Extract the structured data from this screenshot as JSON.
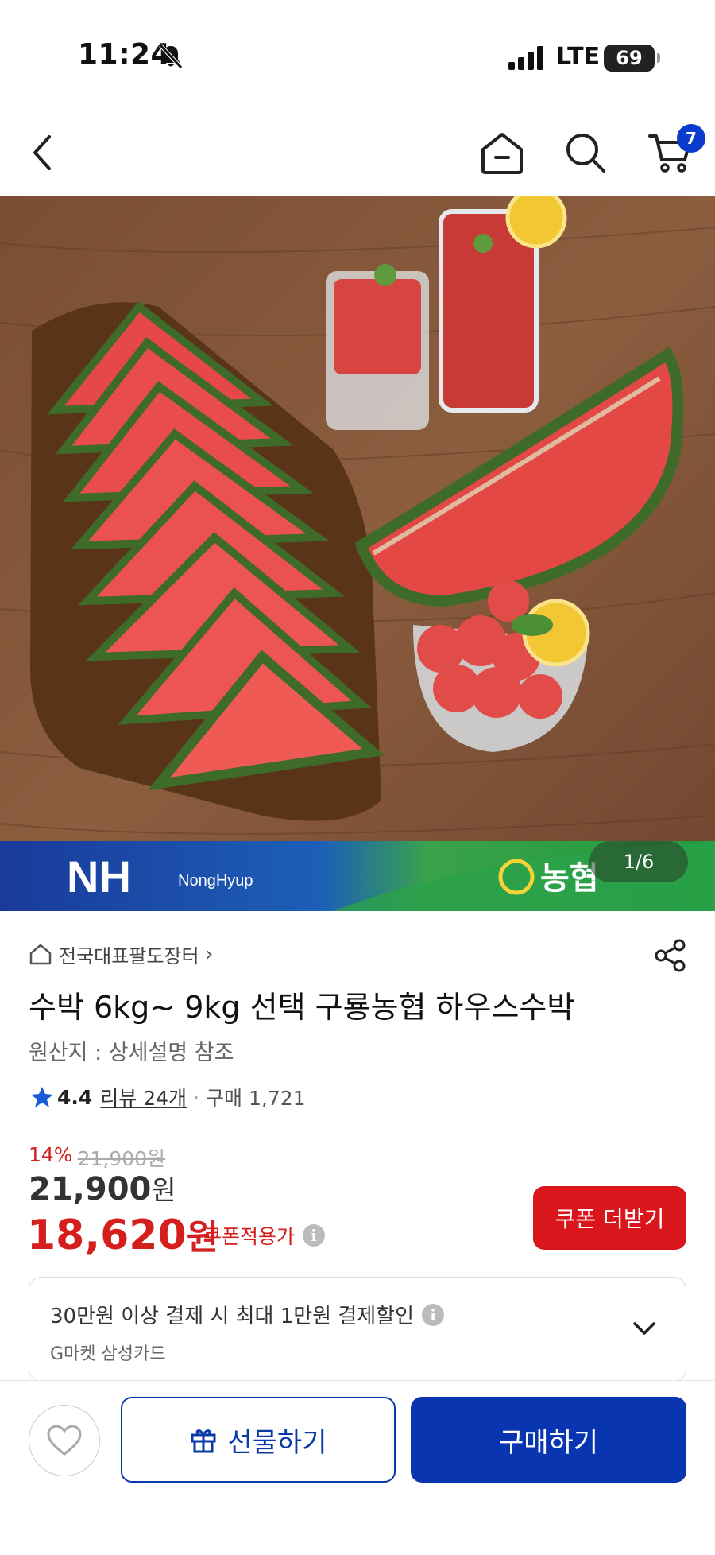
{
  "status_bar": {
    "time": "11:24",
    "network": "LTE",
    "battery": "69"
  },
  "header": {
    "cart_count": "7",
    "icons": [
      "chevron-left-icon",
      "home-icon",
      "search-icon",
      "cart-icon"
    ]
  },
  "hero": {
    "page_indicator": "1/6",
    "brand_left": "NH",
    "brand_left_sub": "NongHyup",
    "brand_right": "농협"
  },
  "product": {
    "shop_name": "전국대표팔도장터",
    "shop_chevron": "›",
    "title": "수박 6kg~ 9kg 선택 구룡농협 하우스수박",
    "origin": "원산지 : 상세설명 참조",
    "rating": "4.4",
    "review_label": "리뷰 24개",
    "separator": "·",
    "purchase_count": "구매 1,721"
  },
  "pricing": {
    "discount_pct": "14%",
    "original_price": "21,900원",
    "price_number": "21,900",
    "price_unit": "원",
    "coupon_price_number": "18,620",
    "coupon_price_unit": "원",
    "coupon_note": "쿠폰적용가",
    "coupon_button": "쿠폰 더받기",
    "info_glyph": "i"
  },
  "card_promo": {
    "main_text": "30만원 이상 결제 시 최대 1만원 결제할인",
    "sub_text": "G마켓 삼성카드"
  },
  "bottom_bar": {
    "gift_label": "선물하기",
    "buy_label": "구매하기"
  },
  "colors": {
    "accent_blue": "#0a35b0",
    "accent_red": "#d51f1f",
    "cart_badge": "#0a3bcc"
  }
}
